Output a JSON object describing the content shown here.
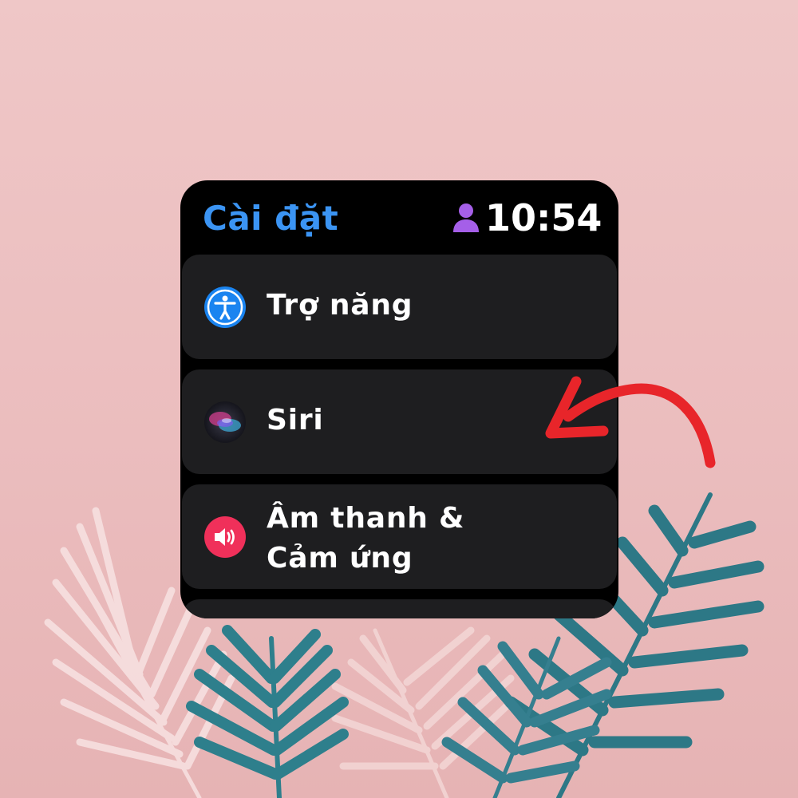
{
  "header": {
    "title": "Cài đặt",
    "time": "10:54"
  },
  "menu": {
    "items": [
      {
        "label": "Trợ năng",
        "icon": "accessibility-icon"
      },
      {
        "label": "Siri",
        "icon": "siri-icon"
      },
      {
        "label_line1": "Âm thanh &",
        "label_line2": "Cảm ứng",
        "icon": "speaker-icon"
      }
    ]
  },
  "colors": {
    "background": "#efc7c7",
    "title": "#3b94f3",
    "accent_person": "#a55fe8",
    "cell": "#1e1e20",
    "arrow": "#e8252a",
    "sound_icon": "#f0305a"
  }
}
